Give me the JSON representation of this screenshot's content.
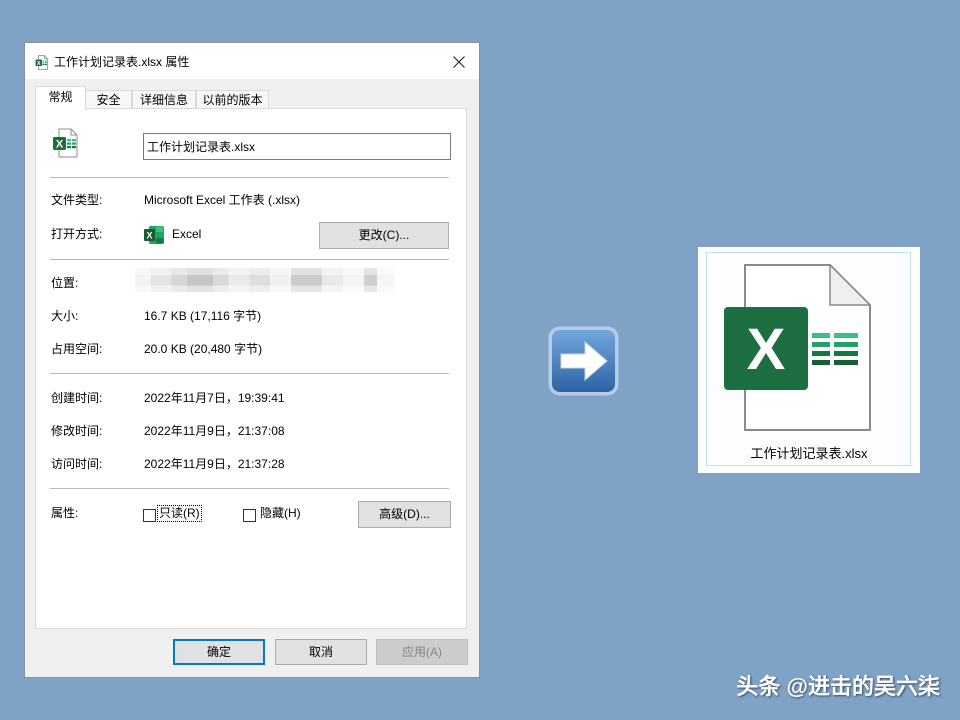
{
  "colors": {
    "desktop_bg": "#7fa3c7",
    "excel_green": "#1d6f42",
    "accent_blue": "#0078d7"
  },
  "excel_logo_letter": "X",
  "dialog": {
    "title": "工作计划记录表.xlsx 属性",
    "title_icon": "excel-file-icon",
    "close_icon": "close-icon",
    "tabs": [
      {
        "label": "常规",
        "active": true
      },
      {
        "label": "安全",
        "active": false
      },
      {
        "label": "详细信息",
        "active": false
      },
      {
        "label": "以前的版本",
        "active": false
      }
    ],
    "general": {
      "file_icon": "excel-file-icon",
      "filename": "工作计划记录表.xlsx",
      "file_type": {
        "label": "文件类型:",
        "value": "Microsoft Excel 工作表 (.xlsx)"
      },
      "open_with": {
        "label": "打开方式:",
        "app_icon": "excel-app-icon",
        "app": "Excel",
        "change_button": "更改(C)..."
      },
      "location": {
        "label": "位置:",
        "value_redacted": true
      },
      "size": {
        "label": "大小:",
        "value": "16.7 KB (17,116 字节)"
      },
      "size_on_disk": {
        "label": "占用空间:",
        "value": "20.0 KB (20,480 字节)"
      },
      "created": {
        "label": "创建时间:",
        "value": "2022年11月7日，19:39:41"
      },
      "modified": {
        "label": "修改时间:",
        "value": "2022年11月9日，21:37:08"
      },
      "accessed": {
        "label": "访问时间:",
        "value": "2022年11月9日，21:37:28"
      },
      "attributes": {
        "label": "属性:",
        "readonly": {
          "label": "只读(R)",
          "checked": false,
          "focused": true
        },
        "hidden": {
          "label": "隐藏(H)",
          "checked": false
        },
        "advanced_button": "高级(D)..."
      }
    },
    "buttons": {
      "ok": "确定",
      "cancel": "取消",
      "apply": "应用(A)",
      "apply_enabled": false
    }
  },
  "arrow": {
    "icon": "arrow-right-icon"
  },
  "file_preview": {
    "icon": "excel-file-icon",
    "label": "工作计划记录表.xlsx",
    "selected": true
  },
  "watermark": "头条 @进击的吴六柒"
}
